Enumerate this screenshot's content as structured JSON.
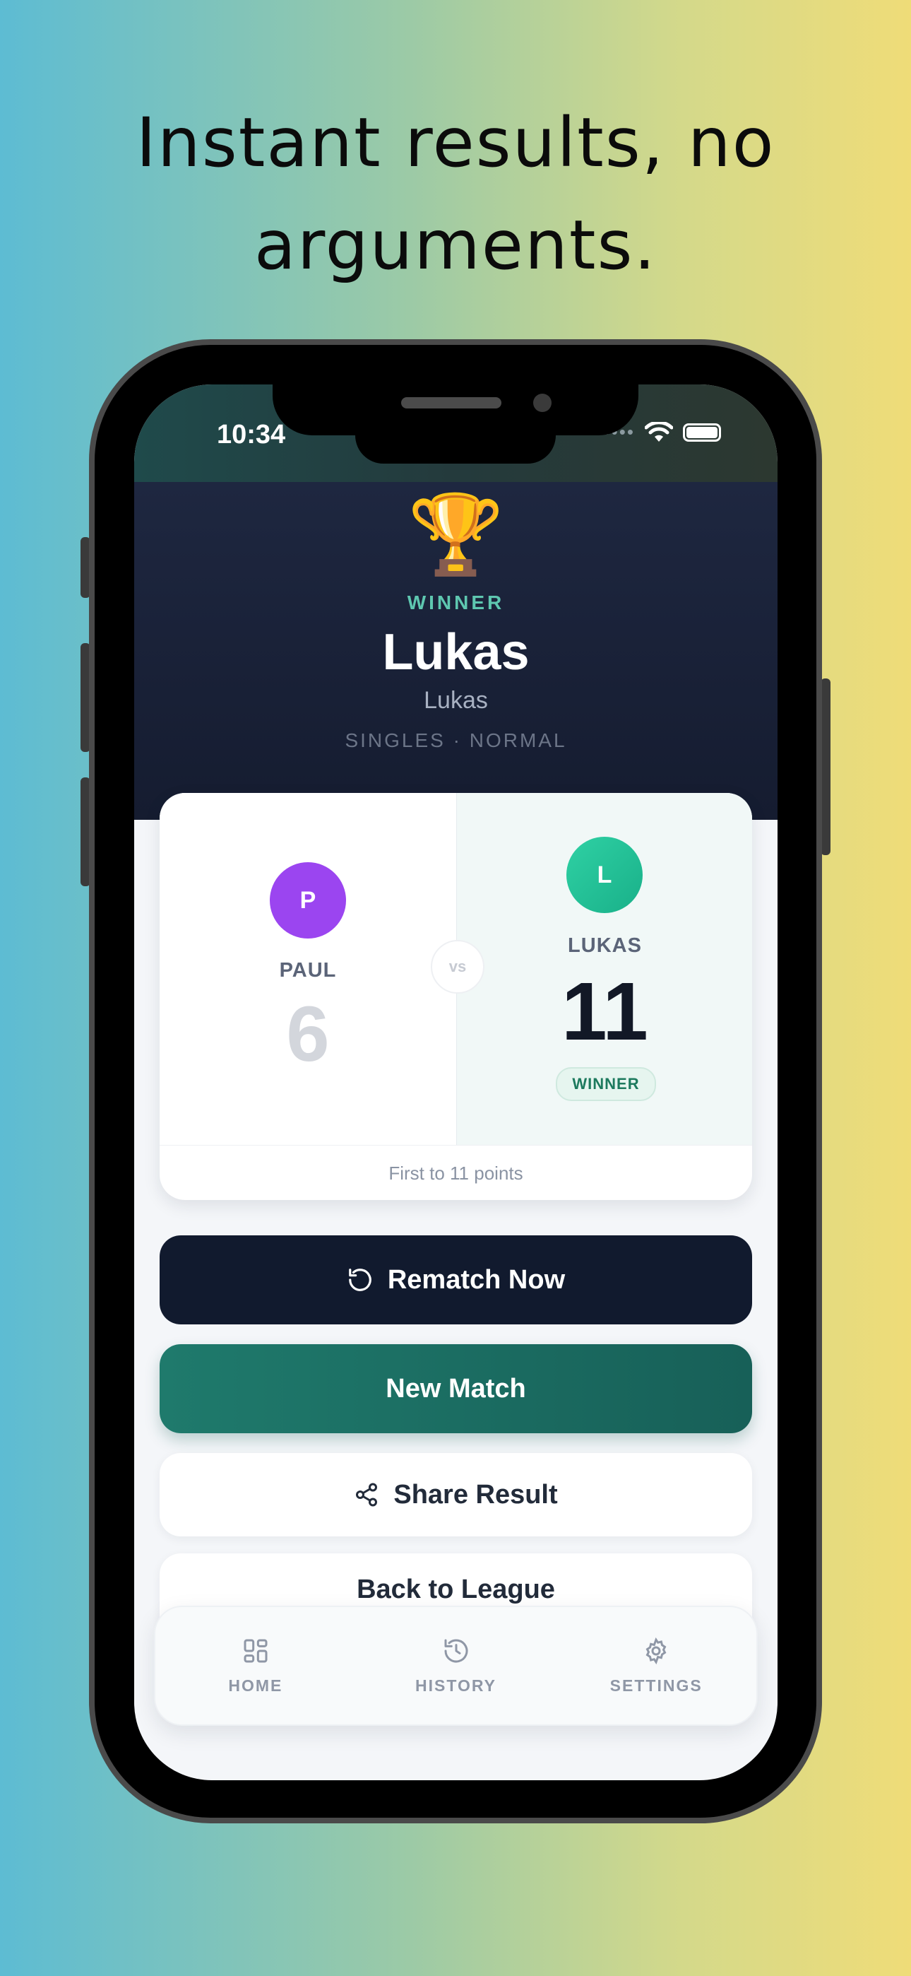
{
  "headline": {
    "line1": "Instant results, no",
    "line2": "arguments."
  },
  "status_bar": {
    "time": "10:34"
  },
  "result": {
    "winner_label": "WINNER",
    "winner_name": "Lukas",
    "winner_sub": "Lukas",
    "mode": "SINGLES · NORMAL",
    "trophy": "🏆"
  },
  "players": {
    "left": {
      "initial": "P",
      "name": "PAUL",
      "score": "6",
      "avatar_color": "#9b45f0"
    },
    "right": {
      "initial": "L",
      "name": "LUKAS",
      "score": "11",
      "avatar_color": "#23c29a",
      "badge": "WINNER"
    }
  },
  "vs_label": "vs",
  "card_footer": "First to 11 points",
  "buttons": {
    "rematch": "Rematch Now",
    "new_match": "New Match",
    "share": "Share Result",
    "back": "Back to League"
  },
  "tabs": [
    {
      "label": "HOME",
      "icon": "grid-icon"
    },
    {
      "label": "HISTORY",
      "icon": "history-icon"
    },
    {
      "label": "SETTINGS",
      "icon": "gear-icon"
    }
  ],
  "colors": {
    "accent": "#1f7a6c",
    "dark": "#111a2e",
    "winner_text": "#5ec7b0"
  }
}
